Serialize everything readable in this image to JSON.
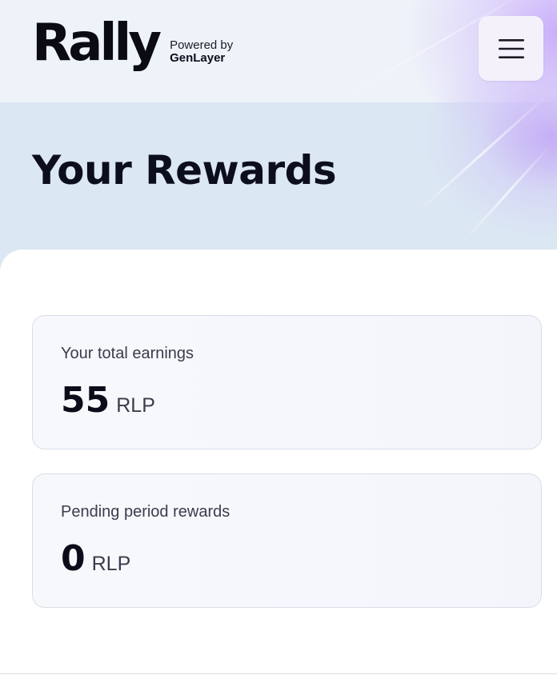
{
  "header": {
    "brand": "Rally",
    "powered_by": "Powered by",
    "partner": "GenLayer",
    "menu_icon": "hamburger-menu-icon"
  },
  "page": {
    "title": "Your Rewards"
  },
  "rewards": {
    "total": {
      "label": "Your total earnings",
      "value": "55",
      "unit": "RLP"
    },
    "pending": {
      "label": "Pending period rewards",
      "value": "0",
      "unit": "RLP"
    }
  },
  "colors": {
    "accent": "#c9aef8",
    "text": "#0b0d1a",
    "hero_bg": "#dbe7f3"
  }
}
